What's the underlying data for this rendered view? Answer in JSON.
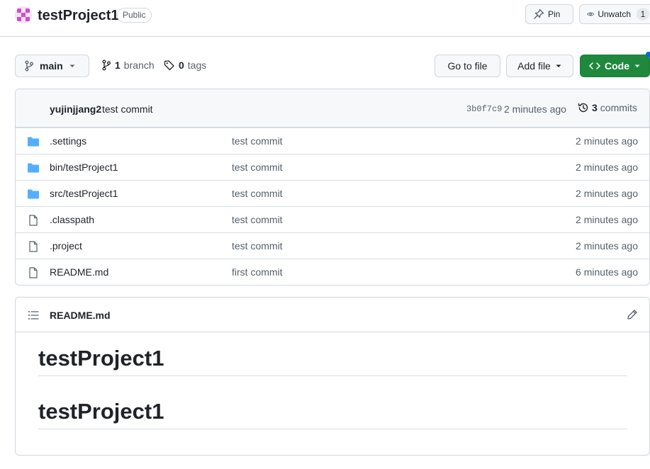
{
  "repo": {
    "name": "testProject1",
    "visibility": "Public",
    "avatar_color": "#d24ec4"
  },
  "header_actions": {
    "pin_label": "Pin",
    "watch_label": "Unwatch",
    "watch_count": "1"
  },
  "toolbar": {
    "branch": "main",
    "branches_count": "1",
    "branches_label": "branch",
    "tags_count": "0",
    "tags_label": "tags",
    "goto_file_label": "Go to file",
    "add_file_label": "Add file",
    "code_label": "Code",
    "code_color": "#1f883d"
  },
  "latest_commit": {
    "author": "yujinjjang2",
    "message": "test commit",
    "sha": "3b0f7c9",
    "time": "2 minutes ago",
    "commits_count": "3",
    "commits_label": "commits"
  },
  "files": [
    {
      "type": "folder",
      "icon": "folder-icon",
      "name": ".settings",
      "commit": "test commit",
      "age": "2 minutes ago"
    },
    {
      "type": "folder",
      "icon": "folder-icon",
      "name": "bin/testProject1",
      "commit": "test commit",
      "age": "2 minutes ago"
    },
    {
      "type": "folder",
      "icon": "folder-icon",
      "name": "src/testProject1",
      "commit": "test commit",
      "age": "2 minutes ago"
    },
    {
      "type": "file",
      "icon": "file-icon",
      "name": ".classpath",
      "commit": "test commit",
      "age": "2 minutes ago"
    },
    {
      "type": "file",
      "icon": "file-icon",
      "name": ".project",
      "commit": "test commit",
      "age": "2 minutes ago"
    },
    {
      "type": "file",
      "icon": "file-icon",
      "name": "README.md",
      "commit": "first commit",
      "age": "6 minutes ago"
    }
  ],
  "readme": {
    "filename": "README.md",
    "headings": [
      "testProject1",
      "testProject1"
    ]
  }
}
